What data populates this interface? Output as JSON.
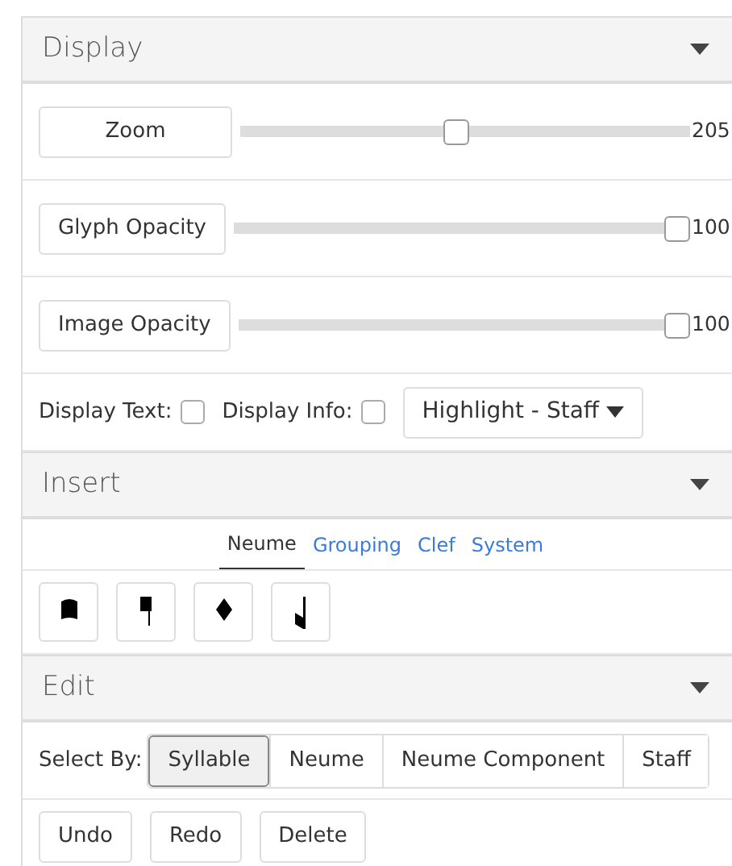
{
  "display": {
    "title": "Display",
    "sliders": [
      {
        "label": "Zoom",
        "level": 0.48,
        "reading": "205"
      },
      {
        "label": "Glyph Opacity",
        "level": 1,
        "reading": "100"
      },
      {
        "label": "Image Opacity",
        "level": 1,
        "reading": "100"
      }
    ],
    "checks": [
      {
        "label": "Display Text:",
        "checked": false
      },
      {
        "label": "Display Info:",
        "checked": false
      }
    ],
    "dropdown": "Highlight - Staff"
  },
  "insert": {
    "title": "Insert",
    "tabs": [
      {
        "label": "Neume",
        "selected": true
      },
      {
        "label": "Grouping",
        "selected": false
      },
      {
        "label": "Clef",
        "selected": false
      },
      {
        "label": "System",
        "selected": false
      }
    ]
  },
  "edit": {
    "title": "Edit",
    "select_label": "Select By:",
    "select_options": [
      {
        "label": "Syllable",
        "selected": true
      },
      {
        "label": "Neume",
        "selected": false
      },
      {
        "label": "Neume Component",
        "selected": false
      },
      {
        "label": "Staff",
        "selected": false
      }
    ],
    "buttons": [
      "Undo",
      "Redo",
      "Delete"
    ]
  }
}
